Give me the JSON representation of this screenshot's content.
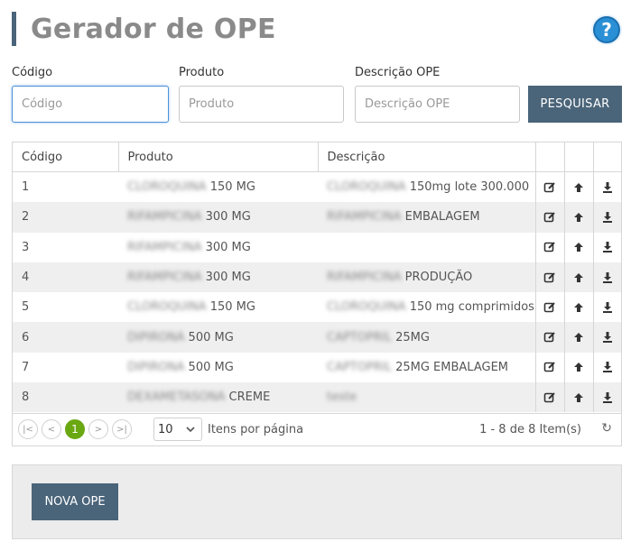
{
  "header": {
    "title": "Gerador de OPE",
    "help": "?"
  },
  "filters": {
    "codigo": {
      "label": "Código",
      "placeholder": "Código",
      "value": ""
    },
    "produto": {
      "label": "Produto",
      "placeholder": "Produto",
      "value": ""
    },
    "descricao": {
      "label": "Descrição OPE",
      "placeholder": "Descrição OPE",
      "value": ""
    },
    "search_label": "PESQUISAR"
  },
  "grid": {
    "columns": [
      "Código",
      "Produto",
      "Descrição"
    ],
    "rows": [
      {
        "codigo": "1",
        "produto_blur": "CLOROQUINA",
        "produto": "150 MG",
        "descricao_blur": "CLOROQUINA",
        "descricao": "150mg lote 300.000"
      },
      {
        "codigo": "2",
        "produto_blur": "RIFAMPICINA",
        "produto": "300 MG",
        "descricao_blur": "RIFAMPICINA",
        "descricao": "EMBALAGEM"
      },
      {
        "codigo": "3",
        "produto_blur": "RIFAMPICINA",
        "produto": "300 MG",
        "descricao_blur": "",
        "descricao": ""
      },
      {
        "codigo": "4",
        "produto_blur": "RIFAMPICINA",
        "produto": "300 MG",
        "descricao_blur": "RIFAMPICINA",
        "descricao": "PRODUÇÃO"
      },
      {
        "codigo": "5",
        "produto_blur": "CLOROQUINA",
        "produto": "150 MG",
        "descricao_blur": "CLOROQUINA",
        "descricao": "150 mg comprimidos"
      },
      {
        "codigo": "6",
        "produto_blur": "DIPIRONA",
        "produto": "500 MG",
        "descricao_blur": "CAPTOPRIL",
        "descricao": "25MG"
      },
      {
        "codigo": "7",
        "produto_blur": "DIPIRONA",
        "produto": "500 MG",
        "descricao_blur": "CAPTOPRIL",
        "descricao": "25MG EMBALAGEM"
      },
      {
        "codigo": "8",
        "produto_blur": "DEXAMETASONA",
        "produto": "CREME",
        "descricao_blur": "teste",
        "descricao": ""
      }
    ],
    "actions": [
      "edit-icon",
      "upload-icon",
      "download-icon"
    ]
  },
  "pager": {
    "current_page": "1",
    "page_size": "10",
    "page_size_label": "Itens por página",
    "info": "1 - 8 de 8 Item(s)"
  },
  "footer": {
    "new_label": "NOVA OPE"
  },
  "colors": {
    "primary": "#4a6479",
    "active_page": "#6aa812",
    "help": "#2a8fd4"
  }
}
